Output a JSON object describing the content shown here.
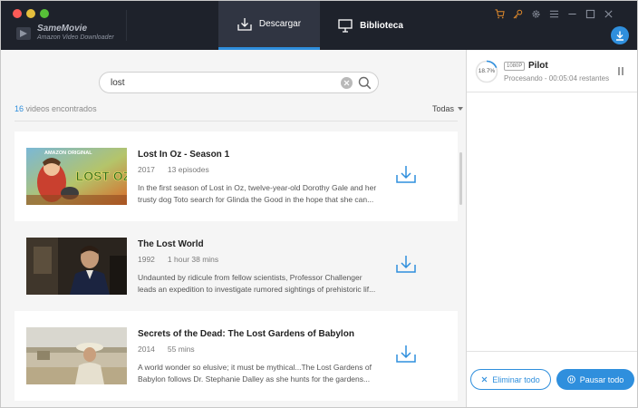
{
  "app": {
    "name": "SameMovie",
    "subtitle": "Amazon Video Downloader"
  },
  "tabs": [
    {
      "label": "Descargar",
      "icon": "download-tray-icon",
      "active": true
    },
    {
      "label": "Biblioteca",
      "icon": "monitor-icon",
      "active": false
    }
  ],
  "toolbar_icons": [
    "cart-icon",
    "key-icon",
    "gear-icon",
    "menu-icon",
    "minimize-icon",
    "maximize-icon",
    "close-icon"
  ],
  "search": {
    "value": "lost",
    "placeholder": ""
  },
  "results": {
    "count": "16",
    "count_suffix": " videos encontrados",
    "filter": "Todas"
  },
  "videos": [
    {
      "title": "Lost In Oz - Season 1",
      "year": "2017",
      "duration": "13 episodes",
      "description": "In the first season of Lost in Oz, twelve-year-old Dorothy Gale and her trusty dog Toto search for Glinda the Good in the hope that she can...",
      "thumb_caption": "AMAZON ORIGINAL",
      "thumb_title": "LOST OZ"
    },
    {
      "title": "The Lost World",
      "year": "1992",
      "duration": "1 hour 38 mins",
      "description": "Undaunted by ridicule from fellow scientists, Professor Challenger leads an expedition to investigate rumored sightings of prehistoric lif..."
    },
    {
      "title": "Secrets of the Dead: The Lost Gardens of Babylon",
      "year": "2014",
      "duration": "55 mins",
      "description": "A world wonder so elusive; it must be mythical...The Lost Gardens of Babylon follows Dr. Stephanie Dalley as she hunts for the gardens..."
    }
  ],
  "download_queue": [
    {
      "progress": "18.7%",
      "progress_fraction": 0.187,
      "quality": "1080P",
      "title": "Pilot",
      "status": "Procesando - 00:05:04 restantes"
    }
  ],
  "footer": {
    "clear_all": "Eliminar todo",
    "pause_all": "Pausar todo"
  },
  "colors": {
    "accent": "#2f8fdd",
    "titlebar": "#1e222b",
    "active_tab": "#303542"
  }
}
